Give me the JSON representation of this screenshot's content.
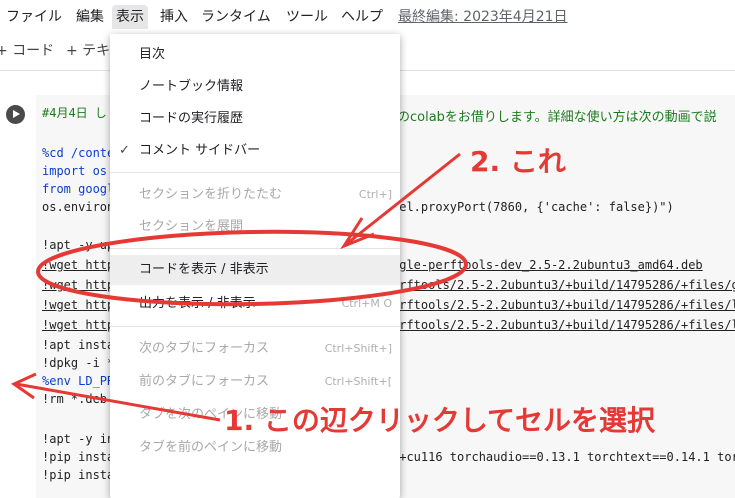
{
  "menubar": {
    "items": [
      "ファイル",
      "編集",
      "表示",
      "挿入",
      "ランタイム",
      "ツール",
      "ヘルプ"
    ],
    "last_edit": "最終編集: 2023年4月21日"
  },
  "toolbar": {
    "add_code": "+ コード",
    "add_text": "+ テキ"
  },
  "cell": {
    "comment": "#4月4日 し",
    "comment_tail": "のcolabをお借りします。詳細な使い方は次の動画で説",
    "lines": [
      {
        "pre": "%cd /conte",
        "tail": ""
      },
      {
        "pre": "import os",
        "tail": ""
      },
      {
        "pre": "from googl",
        "tail": ""
      },
      {
        "pre": "os.environ",
        "tail": "nel.proxyPort(7860, {'cache': false})\")"
      },
      {
        "pre": "!apt -y up",
        "tail": ""
      },
      {
        "pre": "!wget http",
        "tail": "ogle-perftools-dev_2.5-2.2ubuntu3_amd64.deb"
      },
      {
        "pre": "!wget http",
        "tail": "erftools/2.5-2.2ubuntu3/+build/14795286/+files/g"
      },
      {
        "pre": "!wget http",
        "tail": "erftools/2.5-2.2ubuntu3/+build/14795286/+files/l"
      },
      {
        "pre": "!wget http",
        "tail": "erftools/2.5-2.2ubuntu3/+build/14795286/+files/l"
      },
      {
        "pre": "!apt insta",
        "tail": ""
      },
      {
        "pre": "!dpkg -i *",
        "tail": ""
      },
      {
        "pre": "%env LD_PR",
        "tail": ""
      },
      {
        "pre": "!rm *.deb",
        "tail": ""
      },
      {
        "pre": "!apt -y in",
        "tail": ""
      },
      {
        "pre": "!pip insta",
        "tail": "1+cu116 torchaudio==0.13.1 torchtext==0.14.1 tor"
      },
      {
        "pre": "!pip install -q xformers==0.0.16 triton==2.0.0 -U",
        "tail": ""
      }
    ]
  },
  "view_menu": {
    "items": [
      {
        "label": "目次",
        "disabled": false,
        "checked": false,
        "shortcut": ""
      },
      {
        "label": "ノートブック情報",
        "disabled": false,
        "checked": false,
        "shortcut": ""
      },
      {
        "label": "コードの実行履歴",
        "disabled": false,
        "checked": false,
        "shortcut": ""
      },
      {
        "label": "コメント サイドバー",
        "disabled": false,
        "checked": true,
        "shortcut": ""
      },
      {
        "label": "セクションを折りたたむ",
        "disabled": true,
        "checked": false,
        "shortcut": "Ctrl+]"
      },
      {
        "label": "セクションを展開",
        "disabled": true,
        "checked": false,
        "shortcut": ""
      },
      {
        "label": "コードを表示 / 非表示",
        "disabled": false,
        "checked": false,
        "shortcut": ""
      },
      {
        "label": "出力を表示 / 非表示",
        "disabled": false,
        "checked": false,
        "shortcut": "Ctrl+M O"
      },
      {
        "label": "次のタブにフォーカス",
        "disabled": true,
        "checked": false,
        "shortcut": "Ctrl+Shift+]"
      },
      {
        "label": "前のタブにフォーカス",
        "disabled": true,
        "checked": false,
        "shortcut": "Ctrl+Shift+["
      },
      {
        "label": "タブを次のペインに移動",
        "disabled": true,
        "checked": false,
        "shortcut": ""
      },
      {
        "label": "タブを前のペインに移動",
        "disabled": true,
        "checked": false,
        "shortcut": ""
      }
    ],
    "check_mark": "✓"
  },
  "annotations": {
    "label_1": "1. この辺クリックしてセルを選択",
    "label_2": "2. これ",
    "color": "#e53935"
  },
  "colors": {
    "accent": "#e53935",
    "keyword": "#0b40cc",
    "comment": "#1c7a1c"
  }
}
